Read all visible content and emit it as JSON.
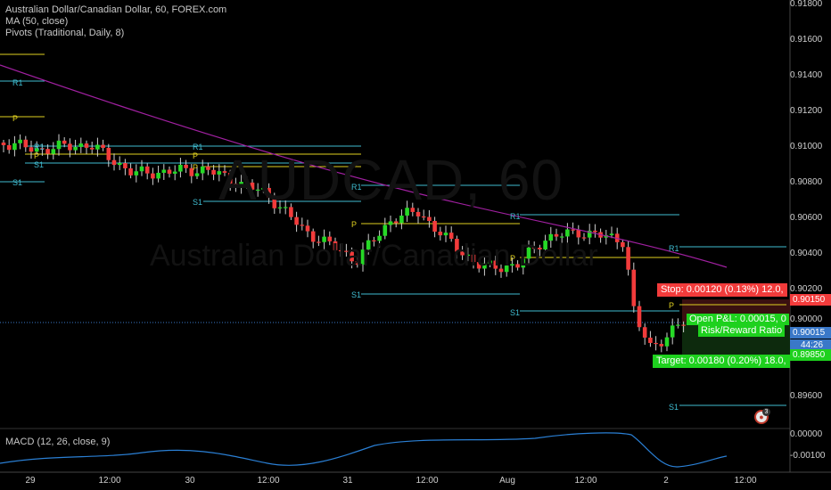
{
  "legend": {
    "symbol_line": "Australian Dollar/Canadian Dollar, 60, FOREX.com",
    "ma_line": "MA (50, close)",
    "pivots_line": "Pivots (Traditional, Daily, 8)"
  },
  "watermark": {
    "ticker": "AUDCAD, 60",
    "name": "Australian Dollar/Canadian Dollar"
  },
  "macd": {
    "legend": "MACD (12, 26, close, 9)",
    "ticks": [
      "0.00000",
      "-0.00100"
    ]
  },
  "price_axis": {
    "ticks": [
      "0.91800",
      "0.91600",
      "0.91400",
      "0.91200",
      "0.91000",
      "0.90800",
      "0.90600",
      "0.90400",
      "0.90200",
      "0.90000",
      "0.89600"
    ],
    "tags": {
      "stop": "0.90150",
      "current": "0.90015",
      "countdown": "44:26",
      "target": "0.89850"
    }
  },
  "time_axis": {
    "labels": [
      "29",
      "12:00",
      "30",
      "12:00",
      "31",
      "12:00",
      "Aug",
      "12:00",
      "2",
      "12:00"
    ]
  },
  "position": {
    "stop_label": "Stop: 0.00120 (0.13%) 12.0,",
    "open_pnl_label": "Open P&L: 0.00015, 0",
    "risk_reward_label": "Risk/Reward Ratio",
    "target_label": "Target: 0.00180 (0.20%) 18.0,"
  },
  "pivot_labels": {
    "r1": "R1",
    "p": "P",
    "s1": "S1"
  },
  "alert_badge": {
    "count": "3"
  },
  "colors": {
    "background": "#000000",
    "up_candle": "#26d926",
    "down_candle": "#f23b3b",
    "ma_line": "#a020a0",
    "pivot_r1": "#3fbcd0",
    "pivot_p": "#e0d020",
    "pivot_s1": "#3fbcd0",
    "macd_line": "#2a7fd4",
    "stop_bg": "#f23b3b",
    "target_bg": "#1ed11e",
    "current_bg": "#3a78c8"
  }
}
